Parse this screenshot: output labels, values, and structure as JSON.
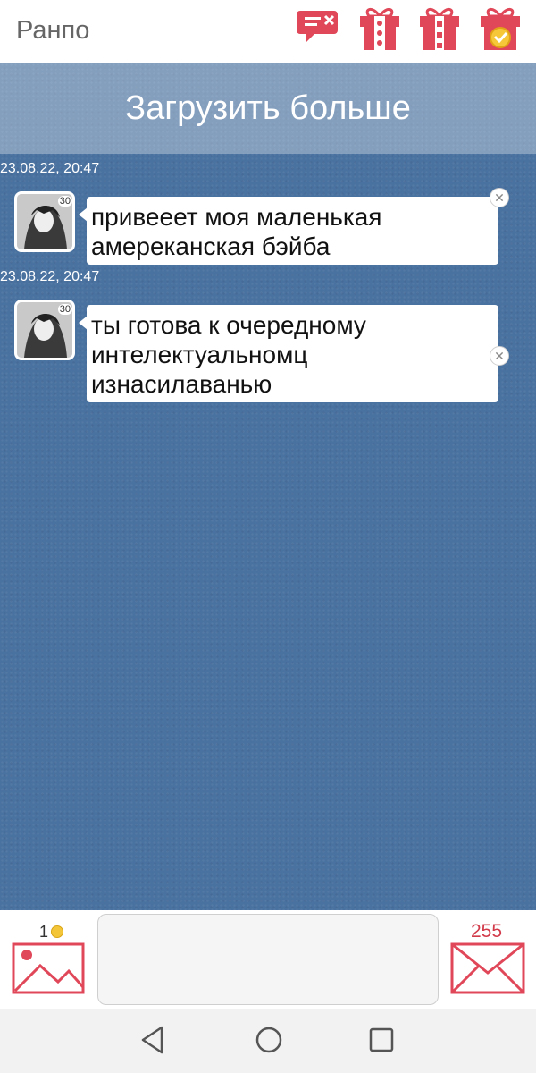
{
  "header": {
    "title": "Ранпо",
    "icons": [
      "message-delete-icon",
      "gift-icon",
      "gift-icon",
      "gift-coin-icon"
    ]
  },
  "chat": {
    "load_more_label": "Загрузить больше",
    "messages": [
      {
        "timestamp": "23.08.22, 20:47",
        "avatar_level": "30",
        "lines": [
          "привееет моя маленькая",
          "амереканская бэйба"
        ]
      },
      {
        "timestamp": "23.08.22, 20:47",
        "avatar_level": "30",
        "lines": [
          "ты готова к очередному",
          "интелектуальномц",
          "изнасилаванью"
        ]
      }
    ]
  },
  "input": {
    "coins": "1",
    "placeholder": "",
    "counter": "255",
    "left_icon": "image-icon",
    "right_icon": "envelope-icon"
  },
  "navbar": {
    "icons": [
      "back-icon",
      "home-icon",
      "recents-icon"
    ]
  },
  "colors": {
    "accent": "#e04758",
    "chat_bg": "#4a72a0"
  }
}
